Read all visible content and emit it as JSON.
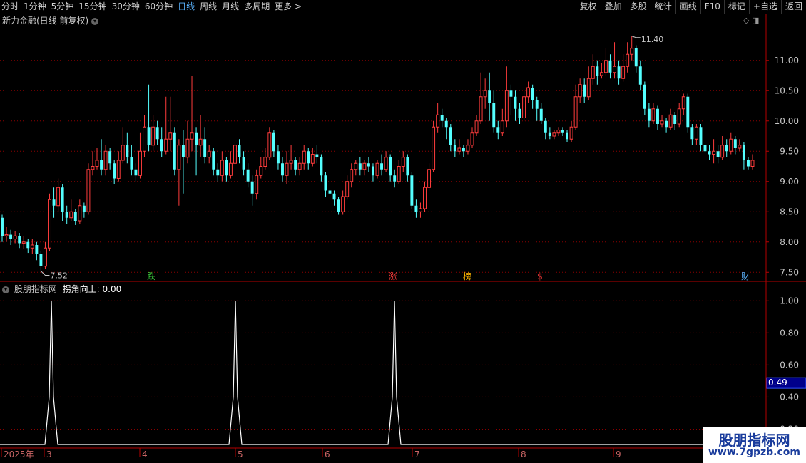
{
  "toolbar": {
    "left_items": [
      {
        "label": "分时",
        "active": false
      },
      {
        "label": "1分钟",
        "active": false
      },
      {
        "label": "5分钟",
        "active": false
      },
      {
        "label": "15分钟",
        "active": false
      },
      {
        "label": "30分钟",
        "active": false
      },
      {
        "label": "60分钟",
        "active": false
      },
      {
        "label": "日线",
        "active": true
      },
      {
        "label": "周线",
        "active": false
      },
      {
        "label": "月线",
        "active": false
      },
      {
        "label": "多周期",
        "active": false
      },
      {
        "label": "更多 >",
        "active": false
      }
    ],
    "right_items": [
      "复权",
      "叠加",
      "多股",
      "统计",
      "画线",
      "F10",
      "标记",
      "+自选",
      "返回"
    ]
  },
  "main_pane": {
    "title": "新力金融(日线 前复权)",
    "dropdown_icon": "chevron-down-icon",
    "y_ticks": [
      "11.00",
      "10.50",
      "10.00",
      "9.50",
      "9.00",
      "8.50",
      "8.00",
      "7.50"
    ],
    "high_label": "11.40",
    "low_label": "7.52",
    "markers": [
      {
        "text": "跌",
        "color": "#3cd23c"
      },
      {
        "text": "涨",
        "color": "#ff3c3c"
      },
      {
        "text": "榜",
        "color": "#ffb400"
      },
      {
        "text": "$",
        "color": "#ff3c3c"
      },
      {
        "text": "财",
        "color": "#5ab4ff"
      }
    ]
  },
  "indicator_pane": {
    "title": "股朋指标网",
    "series_label": "拐角向上: 0.00",
    "y_ticks": [
      "1.00",
      "0.80",
      "0.60",
      "0.40",
      "0.20"
    ],
    "current_value": "0.49"
  },
  "x_axis": {
    "labels": [
      "2025年",
      "3",
      "4",
      "5",
      "6",
      "7",
      "8",
      "9"
    ]
  },
  "colors": {
    "up": "#ff3c3c",
    "down": "#54ffff",
    "grid": "#8b0000",
    "axis": "#b40000",
    "text": "#c8c8c8",
    "indicator_line": "#ffffff"
  },
  "watermark": {
    "title": "股朋指标网",
    "url": "www.7gpzb.com"
  },
  "chart_data": [
    {
      "type": "candlestick",
      "title": "新力金融(日线 前复权)",
      "ylim": [
        7.35,
        11.55
      ],
      "y_ticks": [
        7.5,
        8.0,
        8.5,
        9.0,
        9.5,
        10.0,
        10.5,
        11.0
      ],
      "max": 11.4,
      "min": 7.52,
      "candles": [
        [
          8.4,
          8.1,
          8.0,
          8.45
        ],
        [
          8.1,
          8.12,
          8.0,
          8.25
        ],
        [
          8.12,
          8.05,
          7.95,
          8.2
        ],
        [
          8.05,
          8.1,
          7.98,
          8.18
        ],
        [
          8.1,
          7.98,
          7.9,
          8.15
        ],
        [
          7.98,
          8.0,
          7.88,
          8.1
        ],
        [
          8.0,
          7.9,
          7.82,
          8.05
        ],
        [
          7.9,
          7.95,
          7.8,
          8.05
        ],
        [
          7.95,
          7.8,
          7.7,
          8.0
        ],
        [
          7.8,
          7.6,
          7.52,
          7.85
        ],
        [
          7.6,
          7.9,
          7.55,
          8.0
        ],
        [
          7.9,
          8.7,
          7.85,
          8.8
        ],
        [
          8.7,
          8.6,
          8.4,
          8.9
        ],
        [
          8.6,
          8.9,
          8.5,
          9.05
        ],
        [
          8.9,
          8.5,
          8.35,
          8.95
        ],
        [
          8.5,
          8.4,
          8.3,
          8.6
        ],
        [
          8.4,
          8.5,
          8.35,
          8.7
        ],
        [
          8.5,
          8.35,
          8.28,
          8.55
        ],
        [
          8.35,
          8.6,
          8.3,
          8.7
        ],
        [
          8.6,
          8.5,
          8.4,
          8.65
        ],
        [
          8.5,
          9.2,
          8.45,
          9.3
        ],
        [
          9.2,
          9.25,
          9.1,
          9.5
        ],
        [
          9.25,
          9.35,
          9.2,
          9.55
        ],
        [
          9.35,
          9.2,
          9.1,
          9.7
        ],
        [
          9.2,
          9.5,
          9.1,
          9.6
        ],
        [
          9.5,
          9.3,
          9.2,
          9.55
        ],
        [
          9.3,
          9.05,
          8.95,
          9.35
        ],
        [
          9.05,
          9.35,
          9.0,
          9.5
        ],
        [
          9.35,
          9.6,
          9.3,
          9.9
        ],
        [
          9.6,
          9.4,
          9.3,
          9.8
        ],
        [
          9.4,
          9.2,
          9.1,
          9.6
        ],
        [
          9.2,
          9.1,
          9.0,
          9.3
        ],
        [
          9.1,
          9.5,
          9.05,
          9.8
        ],
        [
          9.5,
          9.9,
          9.4,
          10.1
        ],
        [
          9.9,
          9.6,
          9.5,
          10.6
        ],
        [
          9.6,
          9.9,
          9.5,
          10.1
        ],
        [
          9.9,
          9.7,
          9.6,
          10.0
        ],
        [
          9.7,
          9.5,
          9.4,
          9.9
        ],
        [
          9.5,
          9.7,
          9.45,
          10.4
        ],
        [
          9.7,
          9.8,
          9.5,
          10.4
        ],
        [
          9.8,
          9.2,
          9.1,
          9.9
        ],
        [
          9.2,
          9.6,
          8.6,
          9.7
        ],
        [
          9.6,
          9.4,
          8.8,
          9.85
        ],
        [
          9.4,
          9.7,
          9.3,
          10.0
        ],
        [
          9.7,
          9.8,
          9.5,
          10.75
        ],
        [
          9.8,
          9.6,
          9.1,
          9.9
        ],
        [
          9.6,
          9.7,
          9.4,
          10.1
        ],
        [
          9.7,
          9.4,
          9.3,
          9.9
        ],
        [
          9.4,
          9.5,
          9.3,
          9.6
        ],
        [
          9.5,
          9.2,
          9.1,
          9.55
        ],
        [
          9.2,
          9.1,
          9.0,
          9.3
        ],
        [
          9.1,
          9.35,
          9.0,
          9.5
        ],
        [
          9.35,
          9.1,
          9.0,
          9.4
        ],
        [
          9.1,
          9.3,
          9.05,
          9.5
        ],
        [
          9.3,
          9.6,
          9.2,
          9.65
        ],
        [
          9.6,
          9.4,
          9.3,
          9.7
        ],
        [
          9.4,
          9.2,
          9.1,
          9.5
        ],
        [
          9.2,
          9.0,
          8.9,
          9.3
        ],
        [
          9.0,
          8.8,
          8.6,
          9.1
        ],
        [
          8.8,
          9.1,
          8.7,
          9.2
        ],
        [
          9.1,
          9.25,
          9.05,
          9.4
        ],
        [
          9.25,
          9.4,
          9.2,
          9.55
        ],
        [
          9.4,
          9.8,
          9.35,
          9.9
        ],
        [
          9.8,
          9.5,
          9.4,
          9.85
        ],
        [
          9.5,
          9.3,
          9.2,
          9.6
        ],
        [
          9.3,
          9.1,
          9.0,
          9.4
        ],
        [
          9.1,
          9.3,
          8.95,
          9.5
        ],
        [
          9.3,
          9.35,
          9.2,
          9.6
        ],
        [
          9.35,
          9.2,
          9.1,
          9.4
        ],
        [
          9.2,
          9.3,
          9.1,
          9.4
        ],
        [
          9.3,
          9.5,
          9.2,
          9.6
        ],
        [
          9.5,
          9.3,
          9.2,
          9.55
        ],
        [
          9.3,
          9.45,
          9.25,
          9.55
        ],
        [
          9.45,
          9.4,
          9.3,
          9.6
        ],
        [
          9.4,
          9.1,
          9.0,
          9.45
        ],
        [
          9.1,
          8.85,
          8.75,
          9.15
        ],
        [
          8.85,
          8.8,
          8.7,
          8.9
        ],
        [
          8.8,
          8.7,
          8.6,
          8.85
        ],
        [
          8.7,
          8.5,
          8.45,
          8.75
        ],
        [
          8.5,
          8.75,
          8.45,
          8.85
        ],
        [
          8.75,
          9.0,
          8.7,
          9.1
        ],
        [
          9.0,
          9.2,
          8.9,
          9.3
        ],
        [
          9.2,
          9.3,
          9.1,
          9.35
        ],
        [
          9.3,
          9.2,
          9.1,
          9.4
        ],
        [
          9.2,
          9.3,
          9.1,
          9.35
        ],
        [
          9.3,
          9.25,
          9.15,
          9.4
        ],
        [
          9.25,
          9.1,
          9.0,
          9.3
        ],
        [
          9.1,
          9.3,
          9.05,
          9.35
        ],
        [
          9.3,
          9.2,
          9.1,
          9.45
        ],
        [
          9.2,
          9.4,
          9.15,
          9.5
        ],
        [
          9.4,
          9.1,
          9.0,
          9.45
        ],
        [
          9.1,
          9.0,
          8.9,
          9.2
        ],
        [
          9.0,
          9.25,
          8.95,
          9.35
        ],
        [
          9.25,
          9.4,
          9.15,
          9.5
        ],
        [
          9.4,
          9.1,
          9.0,
          9.45
        ],
        [
          9.1,
          8.6,
          8.55,
          9.15
        ],
        [
          8.6,
          8.5,
          8.4,
          8.7
        ],
        [
          8.5,
          8.55,
          8.4,
          8.65
        ],
        [
          8.55,
          8.9,
          8.5,
          9.0
        ],
        [
          8.9,
          9.2,
          8.85,
          9.3
        ],
        [
          9.2,
          9.9,
          9.15,
          10.0
        ],
        [
          9.9,
          10.1,
          9.8,
          10.3
        ],
        [
          10.1,
          10.0,
          9.9,
          10.2
        ],
        [
          10.0,
          9.9,
          9.7,
          10.05
        ],
        [
          9.9,
          9.6,
          9.5,
          9.95
        ],
        [
          9.6,
          9.5,
          9.4,
          9.7
        ],
        [
          9.5,
          9.55,
          9.45,
          9.7
        ],
        [
          9.55,
          9.5,
          9.4,
          9.6
        ],
        [
          9.5,
          9.6,
          9.45,
          9.7
        ],
        [
          9.6,
          9.8,
          9.55,
          9.9
        ],
        [
          9.8,
          10.0,
          9.75,
          10.1
        ],
        [
          10.0,
          10.4,
          9.95,
          10.8
        ],
        [
          10.4,
          10.5,
          10.2,
          10.7
        ],
        [
          10.5,
          10.3,
          10.0,
          10.8
        ],
        [
          10.3,
          9.9,
          9.8,
          10.5
        ],
        [
          9.9,
          9.8,
          9.7,
          10.0
        ],
        [
          9.8,
          10.0,
          9.75,
          10.2
        ],
        [
          10.0,
          10.5,
          9.9,
          10.9
        ],
        [
          10.5,
          10.4,
          10.1,
          10.6
        ],
        [
          10.4,
          10.2,
          10.0,
          10.5
        ],
        [
          10.2,
          10.05,
          9.95,
          10.3
        ],
        [
          10.05,
          10.4,
          10.0,
          10.5
        ],
        [
          10.4,
          10.55,
          10.3,
          10.65
        ],
        [
          10.55,
          10.35,
          10.2,
          10.6
        ],
        [
          10.35,
          10.2,
          10.0,
          10.4
        ],
        [
          10.2,
          10.0,
          9.95,
          10.3
        ],
        [
          10.0,
          9.8,
          9.7,
          10.05
        ],
        [
          9.8,
          9.75,
          9.7,
          9.9
        ],
        [
          9.75,
          9.8,
          9.7,
          9.85
        ],
        [
          9.8,
          9.85,
          9.75,
          9.9
        ],
        [
          9.85,
          9.8,
          9.75,
          9.9
        ],
        [
          9.8,
          9.7,
          9.65,
          9.85
        ],
        [
          9.7,
          9.9,
          9.65,
          10.0
        ],
        [
          9.9,
          10.4,
          9.85,
          10.6
        ],
        [
          10.4,
          10.6,
          10.3,
          10.7
        ],
        [
          10.6,
          10.4,
          10.3,
          10.7
        ],
        [
          10.4,
          10.7,
          10.35,
          10.9
        ],
        [
          10.7,
          10.9,
          10.6,
          11.1
        ],
        [
          10.9,
          10.75,
          10.6,
          11.0
        ],
        [
          10.75,
          10.8,
          10.7,
          10.95
        ],
        [
          10.8,
          11.0,
          10.75,
          11.2
        ],
        [
          11.0,
          10.8,
          10.7,
          11.1
        ],
        [
          10.8,
          10.9,
          10.7,
          11.3
        ],
        [
          10.9,
          10.7,
          10.6,
          11.0
        ],
        [
          10.7,
          10.9,
          10.65,
          11.1
        ],
        [
          10.9,
          11.1,
          10.8,
          11.3
        ],
        [
          11.1,
          11.2,
          11.0,
          11.4
        ],
        [
          11.2,
          10.9,
          10.8,
          11.25
        ],
        [
          10.9,
          10.6,
          10.5,
          11.0
        ],
        [
          10.6,
          10.2,
          10.1,
          10.65
        ],
        [
          10.2,
          10.0,
          9.9,
          10.3
        ],
        [
          10.0,
          10.2,
          9.95,
          10.3
        ],
        [
          10.2,
          9.95,
          9.85,
          10.25
        ],
        [
          9.95,
          10.0,
          9.9,
          10.1
        ],
        [
          10.0,
          9.9,
          9.8,
          10.05
        ],
        [
          9.9,
          10.1,
          9.85,
          10.2
        ],
        [
          10.1,
          9.95,
          9.85,
          10.15
        ],
        [
          9.95,
          10.2,
          9.9,
          10.3
        ],
        [
          10.2,
          10.4,
          10.1,
          10.45
        ],
        [
          10.4,
          9.9,
          9.8,
          10.45
        ],
        [
          9.9,
          9.7,
          9.6,
          9.95
        ],
        [
          9.7,
          9.9,
          9.6,
          9.95
        ],
        [
          9.9,
          9.6,
          9.5,
          9.95
        ],
        [
          9.6,
          9.5,
          9.4,
          9.65
        ],
        [
          9.5,
          9.45,
          9.35,
          9.6
        ],
        [
          9.45,
          9.5,
          9.3,
          9.7
        ],
        [
          9.5,
          9.4,
          9.3,
          9.6
        ],
        [
          9.4,
          9.6,
          9.35,
          9.75
        ],
        [
          9.6,
          9.5,
          9.4,
          9.7
        ],
        [
          9.5,
          9.7,
          9.45,
          9.8
        ],
        [
          9.7,
          9.55,
          9.45,
          9.75
        ],
        [
          9.55,
          9.6,
          9.5,
          9.7
        ],
        [
          9.6,
          9.35,
          9.2,
          9.65
        ],
        [
          9.35,
          9.25,
          9.2,
          9.4
        ],
        [
          9.25,
          9.35,
          9.2,
          9.45
        ]
      ]
    },
    {
      "type": "line",
      "title": "股朋指标网",
      "series": [
        {
          "name": "拐角向上",
          "values": [
            0,
            0,
            0,
            0,
            0,
            0,
            0,
            0,
            0,
            0,
            0,
            0,
            0,
            0,
            0,
            0,
            0,
            0,
            0,
            0,
            0,
            0,
            0,
            0,
            0,
            0,
            0,
            0,
            0,
            0,
            0,
            0,
            0,
            0,
            0,
            0,
            0,
            0,
            0,
            0,
            0,
            0,
            0,
            0,
            0,
            0,
            0,
            0,
            0,
            0,
            0,
            0,
            0,
            0,
            0,
            0,
            0,
            0,
            0,
            0,
            0,
            0,
            0,
            0,
            0,
            0,
            0,
            0,
            0,
            0,
            0,
            0,
            0,
            0,
            0,
            0,
            0,
            0,
            0,
            0,
            0,
            0,
            0,
            0,
            0,
            0,
            0,
            0,
            0,
            0,
            0,
            0,
            0,
            0,
            0,
            0,
            0,
            0,
            0,
            0,
            0,
            0,
            0,
            0,
            0,
            0,
            0,
            0,
            0,
            0,
            0,
            0,
            0,
            0,
            0,
            0,
            0,
            0,
            0,
            0,
            0,
            0,
            0,
            0,
            0,
            0,
            0,
            0,
            0,
            0,
            0,
            0,
            0,
            0,
            0,
            0,
            0,
            0,
            0,
            0,
            0,
            0,
            0,
            0,
            0,
            0,
            0,
            0,
            0,
            0,
            0,
            0,
            0,
            0,
            0,
            0,
            0,
            0,
            0,
            0,
            0,
            0,
            0,
            0,
            0,
            0,
            0,
            0,
            0,
            0,
            0,
            0,
            0,
            0,
            0,
            0
          ]
        }
      ],
      "spikes": [
        {
          "x": 10,
          "y": 1.0
        },
        {
          "x": 47,
          "y": 1.0
        },
        {
          "x": 79,
          "y": 1.0
        }
      ],
      "ylim": [
        0.1,
        1.05
      ],
      "y_ticks": [
        1.0,
        0.8,
        0.6,
        0.4,
        0.2
      ]
    }
  ]
}
